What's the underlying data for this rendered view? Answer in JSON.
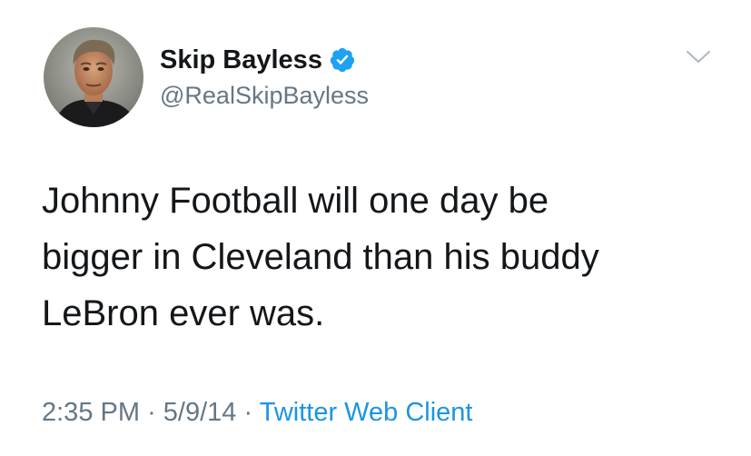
{
  "user": {
    "display_name": "Skip Bayless",
    "handle": "@RealSkipBayless",
    "verified": true
  },
  "tweet": {
    "text_lines": [
      "Johnny Football will one day be",
      "bigger in Cleveland than his buddy",
      "LeBron ever was."
    ],
    "time": "2:35 PM",
    "separator": "·",
    "date": "5/9/14",
    "source": "Twitter Web Client"
  },
  "icons": {
    "verified": "verified-badge-icon",
    "menu": "chevron-down-icon"
  },
  "colors": {
    "text": "#14171a",
    "secondary": "#657786",
    "link": "#1b95e0",
    "verified": "#1da1f2",
    "background": "#ffffff"
  }
}
